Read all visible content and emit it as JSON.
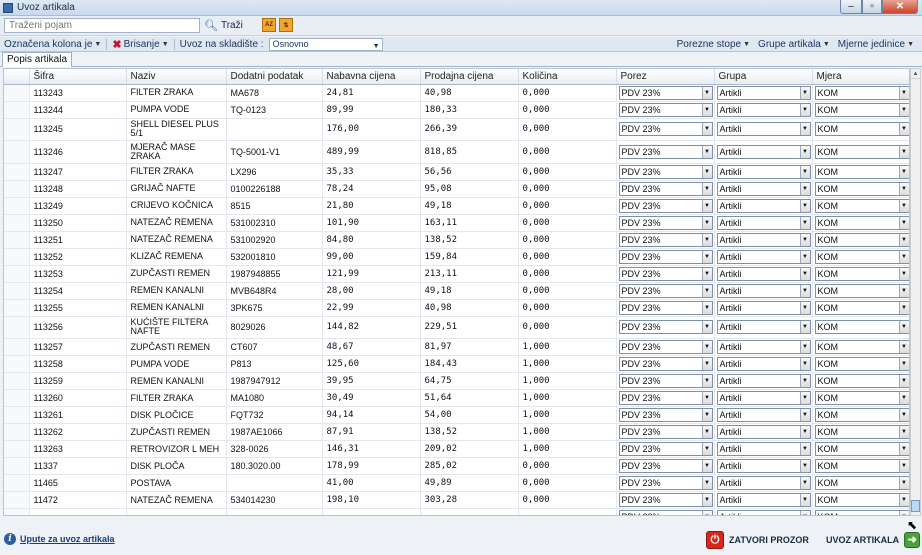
{
  "window": {
    "title": "Uvoz artikala"
  },
  "search": {
    "placeholder": "Traženi pojam",
    "button_label": "Traži"
  },
  "toolbar": {
    "column_menu": "Označena kolona je",
    "delete_menu": "Brisanje",
    "warehouse_label": "Uvoz na skladište :",
    "warehouse_value": "Osnovno",
    "tax_rates": "Porezne stope",
    "article_groups": "Grupe artikala",
    "units": "Mjerne jedinice"
  },
  "tab": {
    "label": "Popis artikala"
  },
  "columns": [
    "Šifra",
    "Naziv",
    "Dodatni podatak",
    "Nabavna cijena",
    "Prodajna cijena",
    "Količina",
    "Porez",
    "Grupa",
    "Mjera"
  ],
  "rows": [
    {
      "code": "113243",
      "name": "FILTER ZRAKA",
      "extra": "MA678",
      "buy": "24,81",
      "sell": "40,98",
      "qty": "0,000",
      "tax": "PDV 23%",
      "group": "Artikli",
      "unit": "KOM"
    },
    {
      "code": "113244",
      "name": "PUMPA VODE",
      "extra": "TQ-0123",
      "buy": "89,99",
      "sell": "180,33",
      "qty": "0,000",
      "tax": "PDV 23%",
      "group": "Artikli",
      "unit": "KOM"
    },
    {
      "code": "113245",
      "name": "SHELL DIESEL PLUS 5/1",
      "extra": "",
      "buy": "176,00",
      "sell": "266,39",
      "qty": "0,000",
      "tax": "PDV 23%",
      "group": "Artikli",
      "unit": "KOM"
    },
    {
      "code": "113246",
      "name": "MJERAČ MASE ZRAKA",
      "extra": "TQ-5001-V1",
      "buy": "489,99",
      "sell": "818,85",
      "qty": "0,000",
      "tax": "PDV 23%",
      "group": "Artikli",
      "unit": "KOM"
    },
    {
      "code": "113247",
      "name": "FILTER ZRAKA",
      "extra": "LX296",
      "buy": "35,33",
      "sell": "56,56",
      "qty": "0,000",
      "tax": "PDV 23%",
      "group": "Artikli",
      "unit": "KOM"
    },
    {
      "code": "113248",
      "name": "GRIJAČ NAFTE",
      "extra": "0100226188",
      "buy": "78,24",
      "sell": "95,08",
      "qty": "0,000",
      "tax": "PDV 23%",
      "group": "Artikli",
      "unit": "KOM"
    },
    {
      "code": "113249",
      "name": "CRIJEVO KOČNICA",
      "extra": "8515",
      "buy": "21,80",
      "sell": "49,18",
      "qty": "0,000",
      "tax": "PDV 23%",
      "group": "Artikli",
      "unit": "KOM"
    },
    {
      "code": "113250",
      "name": "NATEZAČ REMENA",
      "extra": "531002310",
      "buy": "101,90",
      "sell": "163,11",
      "qty": "0,000",
      "tax": "PDV 23%",
      "group": "Artikli",
      "unit": "KOM"
    },
    {
      "code": "113251",
      "name": "NATEZAČ REMENA",
      "extra": "531002920",
      "buy": "84,80",
      "sell": "138,52",
      "qty": "0,000",
      "tax": "PDV 23%",
      "group": "Artikli",
      "unit": "KOM"
    },
    {
      "code": "113252",
      "name": "KLIZAČ REMENA",
      "extra": "532001810",
      "buy": "99,00",
      "sell": "159,84",
      "qty": "0,000",
      "tax": "PDV 23%",
      "group": "Artikli",
      "unit": "KOM"
    },
    {
      "code": "113253",
      "name": "ZUPČASTI REMEN",
      "extra": "1987948855",
      "buy": "121,99",
      "sell": "213,11",
      "qty": "0,000",
      "tax": "PDV 23%",
      "group": "Artikli",
      "unit": "KOM"
    },
    {
      "code": "113254",
      "name": "REMEN KANALNI",
      "extra": "MVB648R4",
      "buy": "28,00",
      "sell": "49,18",
      "qty": "0,000",
      "tax": "PDV 23%",
      "group": "Artikli",
      "unit": "KOM"
    },
    {
      "code": "113255",
      "name": "REMEN KANALNI",
      "extra": "3PK675",
      "buy": "22,99",
      "sell": "40,98",
      "qty": "0,000",
      "tax": "PDV 23%",
      "group": "Artikli",
      "unit": "KOM"
    },
    {
      "code": "113256",
      "name": "KUĆIŠTE FILTERA NAFTE",
      "extra": "8029026",
      "buy": "144,82",
      "sell": "229,51",
      "qty": "0,000",
      "tax": "PDV 23%",
      "group": "Artikli",
      "unit": "KOM"
    },
    {
      "code": "113257",
      "name": "ZUPČASTI REMEN",
      "extra": "CT607",
      "buy": "48,67",
      "sell": "81,97",
      "qty": "1,000",
      "tax": "PDV 23%",
      "group": "Artikli",
      "unit": "KOM"
    },
    {
      "code": "113258",
      "name": "PUMPA VODE",
      "extra": "P813",
      "buy": "125,60",
      "sell": "184,43",
      "qty": "1,000",
      "tax": "PDV 23%",
      "group": "Artikli",
      "unit": "KOM"
    },
    {
      "code": "113259",
      "name": "REMEN KANALNI",
      "extra": "1987947912",
      "buy": "39,95",
      "sell": "64,75",
      "qty": "1,000",
      "tax": "PDV 23%",
      "group": "Artikli",
      "unit": "KOM"
    },
    {
      "code": "113260",
      "name": "FILTER ZRAKA",
      "extra": "MA1080",
      "buy": "30,49",
      "sell": "51,64",
      "qty": "1,000",
      "tax": "PDV 23%",
      "group": "Artikli",
      "unit": "KOM"
    },
    {
      "code": "113261",
      "name": "DISK PLOČICE",
      "extra": "FQT732",
      "buy": "94,14",
      "sell": "54,00",
      "qty": "1,000",
      "tax": "PDV 23%",
      "group": "Artikli",
      "unit": "KOM"
    },
    {
      "code": "113262",
      "name": "ZUPČASTI REMEN",
      "extra": "1987AE1066",
      "buy": "87,91",
      "sell": "138,52",
      "qty": "1,000",
      "tax": "PDV 23%",
      "group": "Artikli",
      "unit": "KOM"
    },
    {
      "code": "113263",
      "name": "RETROVIZOR L MEH",
      "extra": "328-0026",
      "buy": "146,31",
      "sell": "209,02",
      "qty": "1,000",
      "tax": "PDV 23%",
      "group": "Artikli",
      "unit": "KOM"
    },
    {
      "code": "11337",
      "name": "DISK PLOČA",
      "extra": "180.3020.00",
      "buy": "178,99",
      "sell": "285,02",
      "qty": "0,000",
      "tax": "PDV 23%",
      "group": "Artikli",
      "unit": "KOM"
    },
    {
      "code": "11465",
      "name": "POSTAVA",
      "extra": "",
      "buy": "41,00",
      "sell": "49,89",
      "qty": "0,000",
      "tax": "PDV 23%",
      "group": "Artikli",
      "unit": "KOM"
    },
    {
      "code": "11472",
      "name": "NATEZAČ REMENA",
      "extra": "534014230",
      "buy": "198,10",
      "sell": "303,28",
      "qty": "0,000",
      "tax": "PDV 23%",
      "group": "Artikli",
      "unit": "KOM"
    },
    {
      "code": "",
      "name": "",
      "extra": "",
      "buy": "",
      "sell": "",
      "qty": "",
      "tax": "PDV 23%",
      "group": "Artikli",
      "unit": "KOM"
    }
  ],
  "footer": {
    "help_link": "Upute za uvoz artikala",
    "close_button": "ZATVORI PROZOR",
    "import_button": "UVOZ ARTIKALA"
  }
}
